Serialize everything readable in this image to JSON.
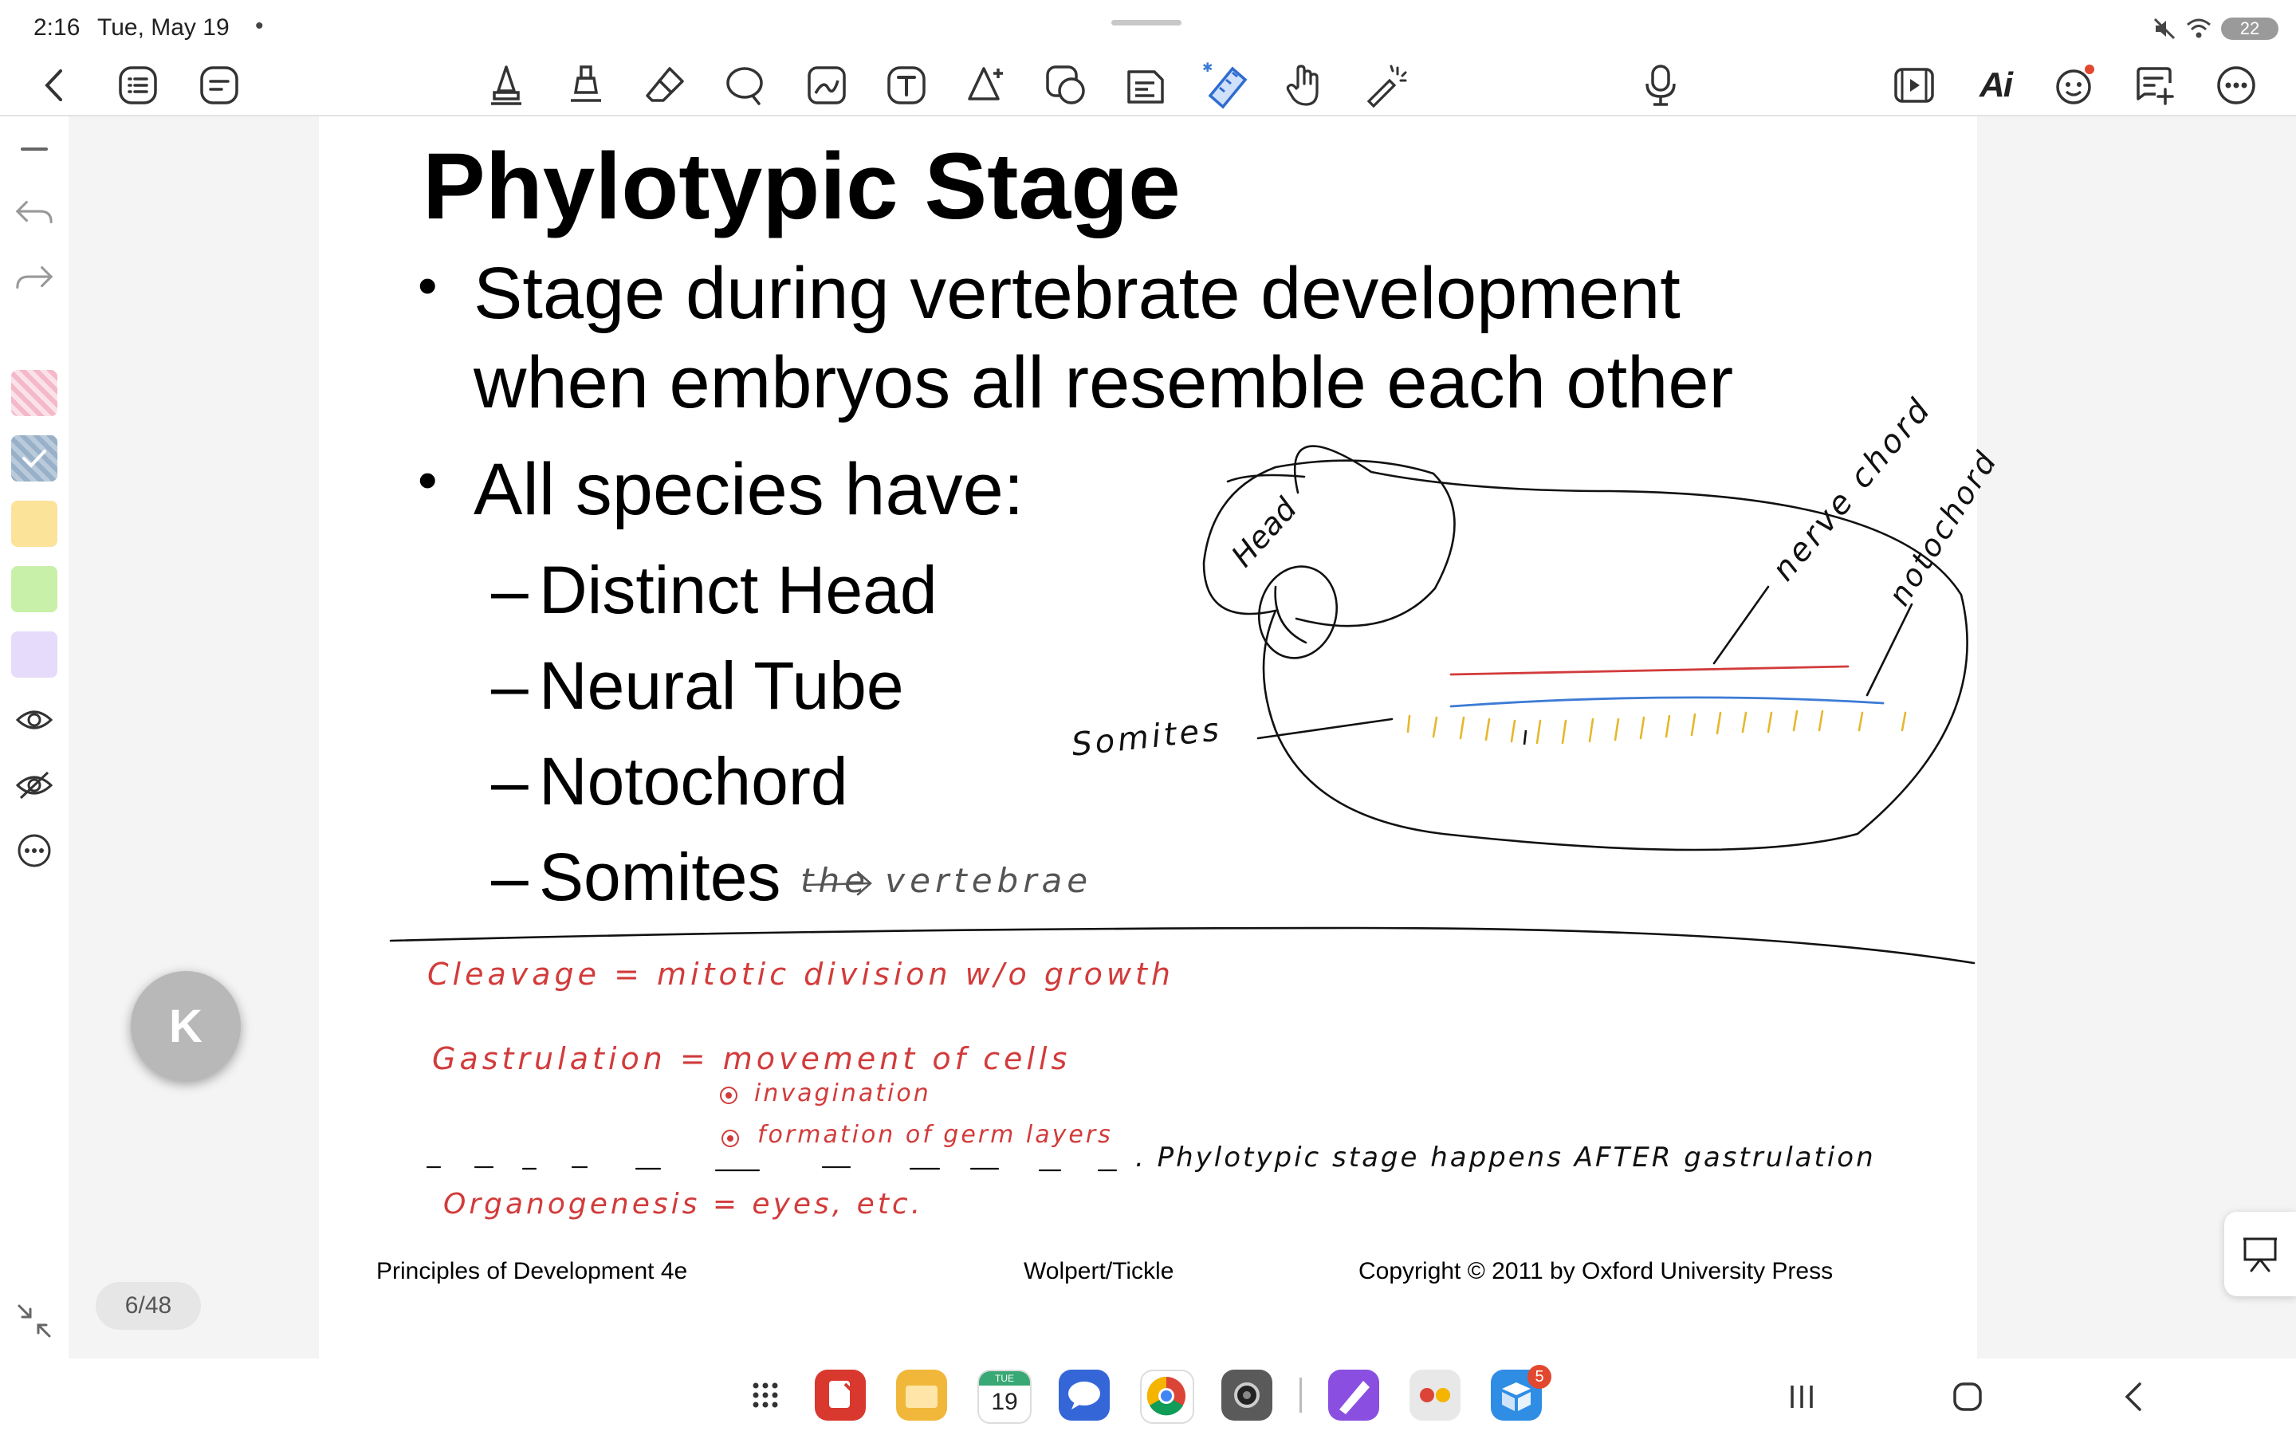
{
  "status_bar": {
    "time": "2:16",
    "date": "Tue, May 19",
    "dot": "•",
    "battery": "22"
  },
  "toolbar": {
    "icons": [
      "back-icon",
      "list-icon",
      "outline-icon",
      "pen-icon",
      "highlighter-icon",
      "eraser-icon",
      "lasso-icon",
      "image-icon",
      "text-icon",
      "shape-icon",
      "sticker-icon",
      "textbox-icon",
      "ruler-icon",
      "hand-icon",
      "laser-icon",
      "microphone-icon",
      "video-icon",
      "ai-icon",
      "emoji-icon",
      "comment-icon",
      "more-icon"
    ],
    "ai_label": "Ai"
  },
  "slide": {
    "title": "Phylotypic Stage",
    "bullet1_line1": "Stage during vertebrate development",
    "bullet1_line2": "when embryos all resemble each other",
    "bullet2": "All species have:",
    "sub_items": [
      "Distinct Head",
      "Neural Tube",
      "Notochord",
      "Somites"
    ],
    "dash": "–",
    "footer_left": "Principles of Development 4e",
    "footer_center": "Wolpert/Tickle",
    "footer_right": "Copyright © 2011 by Oxford University Press"
  },
  "annotations": {
    "vertebrae": "the vertebrae",
    "head": "Head",
    "nerve_chord": "nerve chord",
    "notochord": "notochord",
    "somites": "Somites",
    "cleavage": "Cleavage = mitotic division w/o growth",
    "gastrulation": "Gastrulation = movement of cells",
    "invagination": "invagination",
    "germ_layers": "formation of germ layers",
    "phylotypic_note": ". Phylotypic stage happens AFTER gastrulation",
    "organogenesis": "Organogenesis = eyes, etc."
  },
  "colors": {
    "red_ink": "#d23b3b",
    "blue_ink": "#3d7bd6",
    "yellow_ink": "#e6b72e",
    "swatch_pink": "#f5c6d2",
    "swatch_blue": "#a9bfd3",
    "swatch_yellow": "#fbe39a",
    "swatch_green": "#c9f0a8",
    "swatch_purple": "#e6dbfb"
  },
  "page_indicator": "6/48",
  "k_button": "K",
  "notification_badge": "5",
  "calendar_day": "19",
  "calendar_dow": "TUE"
}
